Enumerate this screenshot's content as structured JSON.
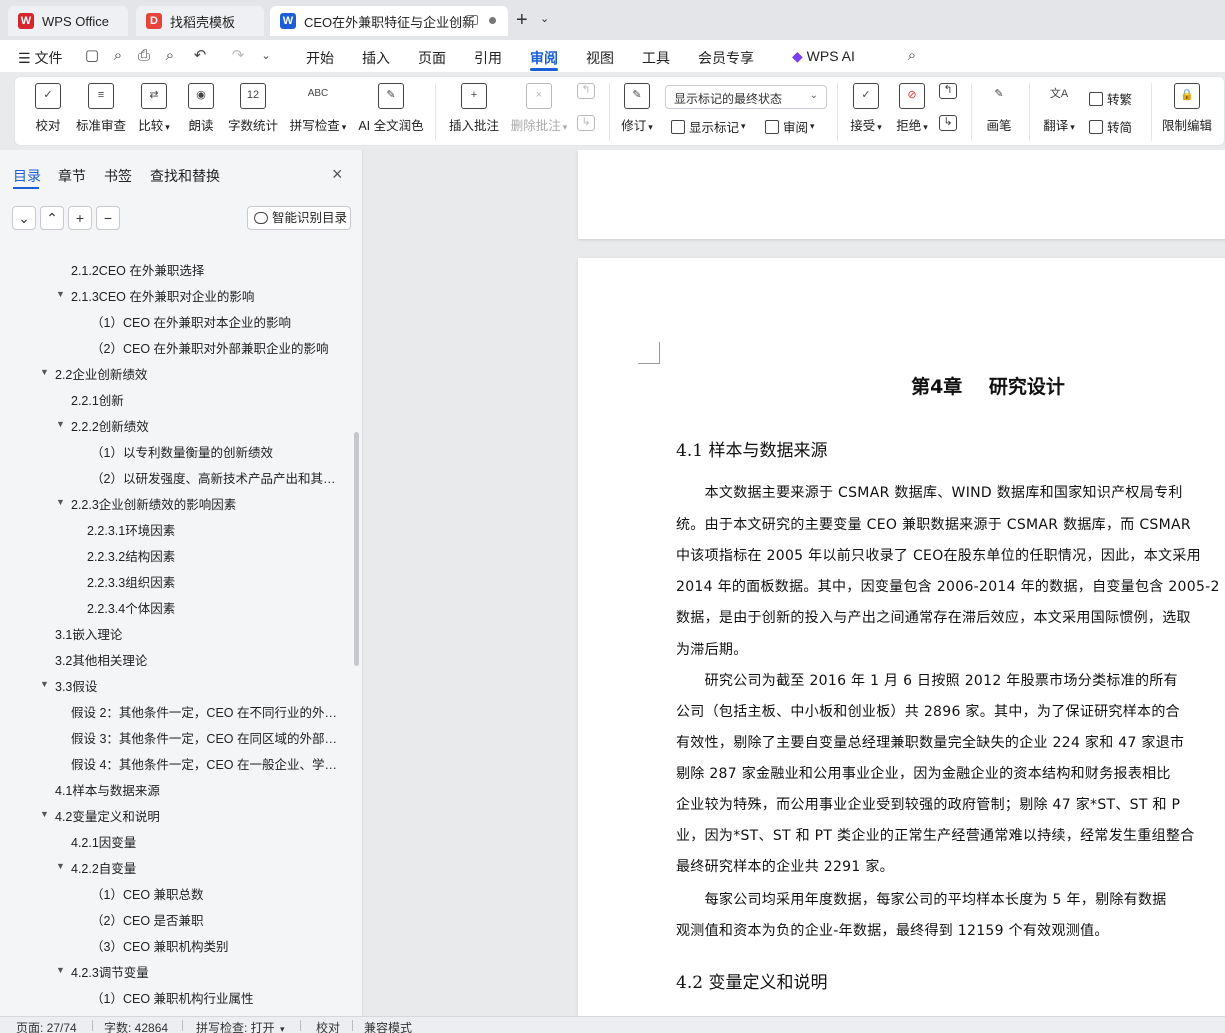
{
  "tabs": [
    {
      "label": "WPS Office",
      "icon": "wps-logo-icon",
      "color": "#d6262d"
    },
    {
      "label": "找稻壳模板",
      "icon": "docer-icon",
      "color": "#e8423b"
    },
    {
      "label": "CEO在外兼职特征与企业创新",
      "icon": "word-doc-icon",
      "color": "#1a5fd6"
    }
  ],
  "menu": {
    "file": "文件",
    "items": [
      "开始",
      "插入",
      "页面",
      "引用",
      "审阅",
      "视图",
      "工具",
      "会员专享"
    ],
    "active": "审阅",
    "ai": "WPS AI"
  },
  "ribbon": {
    "proofread": "校对",
    "std_review": "标准审查",
    "compare": "比较",
    "read_aloud": "朗读",
    "word_count": "字数统计",
    "spell_check": "拼写检查",
    "ai_polish": "AI 全文润色",
    "insert_comment": "插入批注",
    "delete_comment": "删除批注",
    "revise": "修订",
    "markup_state": "显示标记的最终状态",
    "show_markup": "显示标记",
    "review": "审阅",
    "accept": "接受",
    "reject": "拒绝",
    "pen": "画笔",
    "translate": "翻译",
    "to_trad": "转繁",
    "to_simp": "转简",
    "restrict": "限制编辑"
  },
  "nav": {
    "tabs": [
      "目录",
      "章节",
      "书签",
      "查找和替换"
    ],
    "smart_toc": "智能识别目录",
    "toc": [
      {
        "label": "2.1.2CEO 在外兼职选择",
        "level": 2,
        "tri": false
      },
      {
        "label": "2.1.3CEO 在外兼职对企业的影响",
        "level": 2,
        "tri": true
      },
      {
        "label": "（1）CEO 在外兼职对本企业的影响",
        "level": 3,
        "tri": false
      },
      {
        "label": "（2）CEO 在外兼职对外部兼职企业的影响",
        "level": 3,
        "tri": false
      },
      {
        "label": "2.2企业创新绩效",
        "level": 1,
        "tri": true
      },
      {
        "label": "2.2.1创新",
        "level": 2,
        "tri": false
      },
      {
        "label": "2.2.2创新绩效",
        "level": 2,
        "tri": true
      },
      {
        "label": "（1）以专利数量衡量的创新绩效",
        "level": 3,
        "tri": false
      },
      {
        "label": "（2）以研发强度、高新技术产品产出和其他 ...",
        "level": 3,
        "tri": false
      },
      {
        "label": "2.2.3企业创新绩效的影响因素",
        "level": 2,
        "tri": true
      },
      {
        "label": "2.2.3.1环境因素",
        "level": 3,
        "tri": false
      },
      {
        "label": "2.2.3.2结构因素",
        "level": 3,
        "tri": false
      },
      {
        "label": "2.2.3.3组织因素",
        "level": 3,
        "tri": false
      },
      {
        "label": "2.2.3.4个体因素",
        "level": 3,
        "tri": false
      },
      {
        "label": "3.1嵌入理论",
        "level": 1,
        "tri": false
      },
      {
        "label": "3.2其他相关理论",
        "level": 1,
        "tri": false
      },
      {
        "label": "3.3假设",
        "level": 1,
        "tri": true
      },
      {
        "label": "假设 2：其他条件一定，CEO 在不同行业的外部 ...",
        "level": 2,
        "tri": false
      },
      {
        "label": "假设 3：其他条件一定，CEO 在同区域的外部机 ...",
        "level": 2,
        "tri": false
      },
      {
        "label": "假设 4：其他条件一定，CEO 在一般企业、学术 ...",
        "level": 2,
        "tri": false
      },
      {
        "label": "4.1样本与数据来源",
        "level": 1,
        "tri": false
      },
      {
        "label": "4.2变量定义和说明",
        "level": 1,
        "tri": true
      },
      {
        "label": "4.2.1因变量",
        "level": 2,
        "tri": false
      },
      {
        "label": "4.2.2自变量",
        "level": 2,
        "tri": true
      },
      {
        "label": "（1）CEO 兼职总数",
        "level": 3,
        "tri": false
      },
      {
        "label": "（2）CEO 是否兼职",
        "level": 3,
        "tri": false
      },
      {
        "label": "（3）CEO 兼职机构类别",
        "level": 3,
        "tri": false
      },
      {
        "label": "4.2.3调节变量",
        "level": 2,
        "tri": true
      },
      {
        "label": "（1）CEO 兼职机构行业属性",
        "level": 3,
        "tri": false
      }
    ]
  },
  "doc": {
    "chapter": "第4章 研究设计",
    "sec1": "4.1 样本与数据来源",
    "lines": [
      "　　本文数据主要来源于 CSMAR 数据库、WIND 数据库和国家知识产权局专利",
      "统。由于本文研究的主要变量 CEO 兼职数据来源于 CSMAR 数据库，而 CSMAR",
      "中该项指标在 2005 年以前只收录了 CEO在股东单位的任职情况，因此，本文采用",
      "2014 年的面板数据。其中，因变量包含 2006-2014 年的数据，自变量包含 2005-2",
      "数据，是由于创新的投入与产出之间通常存在滞后效应，本文采用国际惯例，选取",
      "为滞后期。",
      "　　研究公司为截至 2016 年 1 月 6 日按照 2012 年股票市场分类标准的所有",
      "公司（包括主板、中小板和创业板）共 2896 家。其中，为了保证研究样本的合",
      "有效性，剔除了主要自变量总经理兼职数量完全缺失的企业 224 家和 47 家退市",
      "剔除 287 家金融业和公用事业企业，因为金融企业的资本结构和财务报表相比",
      "企业较为特殊，而公用事业企业受到较强的政府管制；剔除 47 家*ST、ST 和 P",
      "业，因为*ST、ST 和 PT 类企业的正常生产经营通常难以持续，经常发生重组整合",
      "最终研究样本的企业共 2291 家。",
      "　　每家公司均采用年度数据，每家公司的平均样本长度为 5 年，剔除有数据",
      "观测值和资本为负的企业-年数据，最终得到 12159 个有效观测值。"
    ],
    "sec2": "4.2 变量定义和说明"
  },
  "status": {
    "page": "页面: 27/74",
    "words": "字数: 42864",
    "spell": "拼写检查: 打开",
    "proof": "校对",
    "compat": "兼容模式"
  }
}
